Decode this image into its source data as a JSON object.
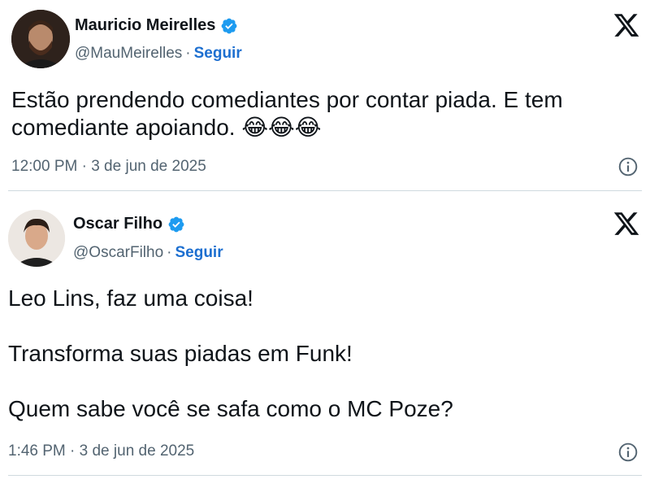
{
  "tweets": [
    {
      "author_name": "Mauricio Meirelles",
      "handle": "@MauMeirelles",
      "follow_label": "Seguir",
      "text": "Estão prendendo comediantes por contar piada. E tem comediante apoiando.",
      "emojis": "😂😂😂",
      "timestamp": "12:00 PM · 3 de jun de 2025",
      "icons": [
        "verified-badge-icon",
        "x-logo-icon",
        "info-icon"
      ]
    },
    {
      "author_name": "Oscar Filho",
      "handle": "@OscarFilho",
      "follow_label": "Seguir",
      "paragraphs": [
        "Leo Lins, faz uma coisa!",
        "Transforma suas piadas em Funk!",
        "Quem sabe você se safa como o MC Poze?"
      ],
      "timestamp": "1:46 PM · 3 de jun de 2025",
      "icons": [
        "verified-badge-icon",
        "x-logo-icon",
        "info-icon"
      ]
    }
  ],
  "colors": {
    "text": "#0f1419",
    "secondary": "#536471",
    "link": "#1d6fd0",
    "verified": "#1d9bf0",
    "divider": "#cfd9de"
  }
}
